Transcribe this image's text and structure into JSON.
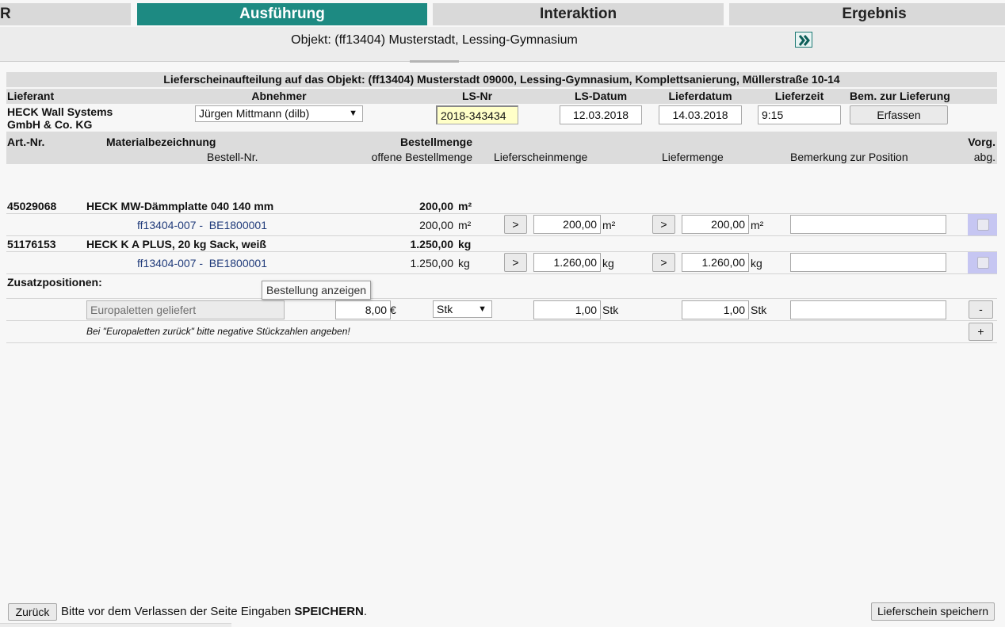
{
  "tabs": [
    {
      "label": "R"
    },
    {
      "label": "Ausführung"
    },
    {
      "label": "Interaktion"
    },
    {
      "label": "Ergebnis"
    }
  ],
  "object_line": "Objekt: (ff13404) Musterstadt, Lessing-Gymnasium",
  "table_title": "Lieferscheinaufteilung auf das Objekt: (ff13404) Musterstadt 09000, Lessing-Gymnasium, Komplettsanierung, Müllerstraße 10-14",
  "header": {
    "lieferant_label": "Lieferant",
    "abnehmer_label": "Abnehmer",
    "lsnr_label": "LS-Nr",
    "lsdatum_label": "LS-Datum",
    "lieferdatum_label": "Lieferdatum",
    "lieferzeit_label": "Lieferzeit",
    "bem_label": "Bem. zur Lieferung"
  },
  "delivery": {
    "supplier_line1": "HECK Wall Systems",
    "supplier_line2": "GmbH & Co. KG",
    "recipient": "Jürgen Mittmann (dilb)",
    "ls_nr": "2018-343434",
    "ls_datum": "12.03.2018",
    "lieferdatum": "14.03.2018",
    "lieferzeit": "9:15",
    "erfassen_label": "Erfassen"
  },
  "columns": {
    "art_nr": "Art.-Nr.",
    "material": "Materialbezeichnung",
    "bestellmenge": "Bestellmenge",
    "vorg": "Vorg.",
    "bestell_nr": "Bestell-Nr.",
    "offene": "offene Bestellmenge",
    "lieferscheinmenge": "Lieferscheinmenge",
    "liefermenge": "Liefermenge",
    "bemerkung": "Bemerkung zur Position",
    "abg": "abg."
  },
  "items": [
    {
      "art_nr": "45029068",
      "name": "HECK MW-Dämmplatte 040 140 mm",
      "bestellmenge": "200,00",
      "unit": "m²",
      "order_ref": "ff13404-007 -  BE1800001",
      "open_qty": "200,00",
      "ls_qty": "200,00",
      "liefer_qty": "200,00"
    },
    {
      "art_nr": "51176153",
      "name": "HECK K A PLUS, 20 kg Sack, weiß",
      "bestellmenge": "1.250,00",
      "unit": "kg",
      "order_ref": "ff13404-007 -  BE1800001",
      "open_qty": "1.250,00",
      "ls_qty": "1.260,00",
      "liefer_qty": "1.260,00"
    }
  ],
  "arrow_label": ">",
  "zusatz": {
    "label": "Zusatzpositionen:",
    "tooltip": "Bestellung anzeigen",
    "placeholder": "Europaletten geliefert",
    "price": "8,00",
    "currency": "€",
    "unit_select": "Stk",
    "ls_qty": "1,00",
    "liefer_qty": "1,00",
    "unit": "Stk",
    "minus_label": "-",
    "plus_label": "+",
    "hint": "Bei \"Europaletten zurück\" bitte negative Stückzahlen angeben!"
  },
  "footer": {
    "back_label": "Zurück",
    "message_prefix": "Bitte vor dem Verlassen der Seite Eingaben ",
    "message_bold": "SPEICHERN",
    "message_suffix": ".",
    "save_label": "Lieferschein speichern"
  },
  "colors": {
    "accent": "#1d8a82",
    "ls_nr_highlight": "#ffffc8",
    "checkbox_cell": "#c6c6f2"
  },
  "icons": {
    "forward": "double-chevron-right"
  }
}
